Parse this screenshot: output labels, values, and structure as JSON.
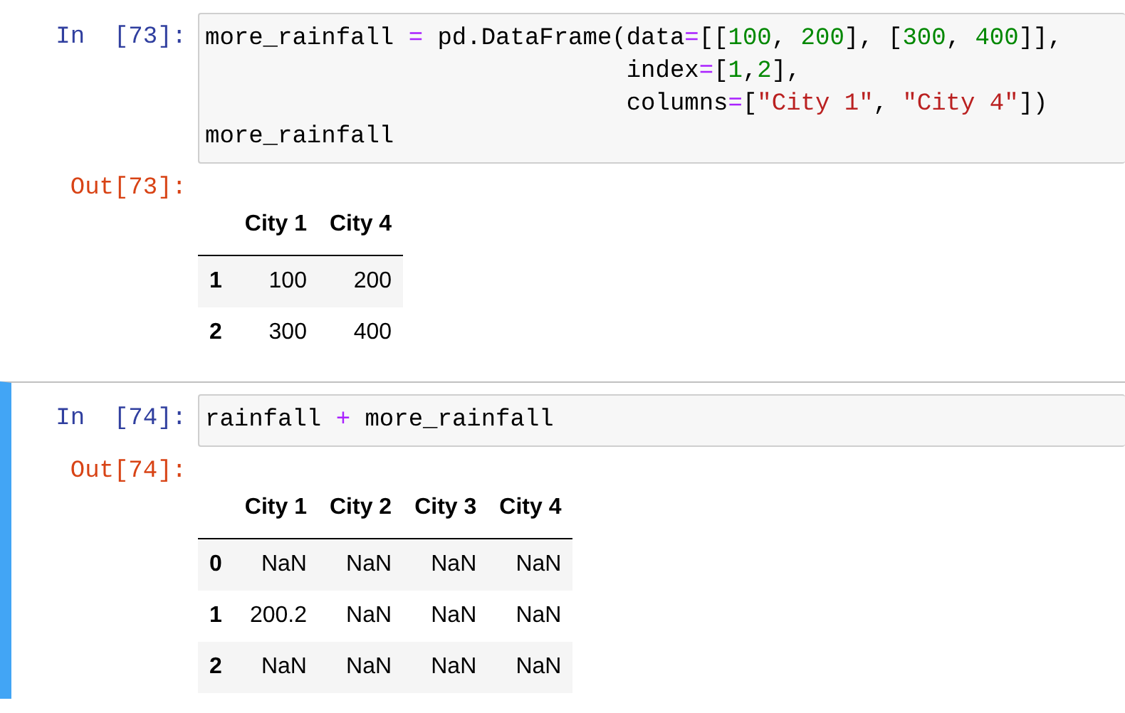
{
  "cells": [
    {
      "selected": false,
      "in_prompt": "In  [73]:",
      "code": [
        [
          {
            "kind": "plain",
            "text": "more_rainfall "
          },
          {
            "kind": "op",
            "text": "="
          },
          {
            "kind": "plain",
            "text": " pd.DataFrame(data"
          },
          {
            "kind": "op",
            "text": "="
          },
          {
            "kind": "plain",
            "text": "[["
          },
          {
            "kind": "num",
            "text": "100"
          },
          {
            "kind": "plain",
            "text": ", "
          },
          {
            "kind": "num",
            "text": "200"
          },
          {
            "kind": "plain",
            "text": "], ["
          },
          {
            "kind": "num",
            "text": "300"
          },
          {
            "kind": "plain",
            "text": ", "
          },
          {
            "kind": "num",
            "text": "400"
          },
          {
            "kind": "plain",
            "text": "]],"
          }
        ],
        [
          {
            "kind": "plain",
            "text": "                             index"
          },
          {
            "kind": "op",
            "text": "="
          },
          {
            "kind": "plain",
            "text": "["
          },
          {
            "kind": "num",
            "text": "1"
          },
          {
            "kind": "plain",
            "text": ","
          },
          {
            "kind": "num",
            "text": "2"
          },
          {
            "kind": "plain",
            "text": "],"
          }
        ],
        [
          {
            "kind": "plain",
            "text": "                             columns"
          },
          {
            "kind": "op",
            "text": "="
          },
          {
            "kind": "plain",
            "text": "["
          },
          {
            "kind": "str",
            "text": "\"City 1\""
          },
          {
            "kind": "plain",
            "text": ", "
          },
          {
            "kind": "str",
            "text": "\"City 4\""
          },
          {
            "kind": "plain",
            "text": "])"
          }
        ],
        [
          {
            "kind": "plain",
            "text": "more_rainfall"
          }
        ]
      ],
      "out_prompt": "Out[73]:",
      "table": {
        "columns": [
          "City 1",
          "City 4"
        ],
        "rows": [
          {
            "index": "1",
            "values": [
              "100",
              "200"
            ]
          },
          {
            "index": "2",
            "values": [
              "300",
              "400"
            ]
          }
        ]
      }
    },
    {
      "selected": true,
      "in_prompt": "In  [74]:",
      "code": [
        [
          {
            "kind": "plain",
            "text": "rainfall "
          },
          {
            "kind": "op",
            "text": "+"
          },
          {
            "kind": "plain",
            "text": " more_rainfall"
          }
        ]
      ],
      "out_prompt": "Out[74]:",
      "table": {
        "columns": [
          "City 1",
          "City 2",
          "City 3",
          "City 4"
        ],
        "rows": [
          {
            "index": "0",
            "values": [
              "NaN",
              "NaN",
              "NaN",
              "NaN"
            ]
          },
          {
            "index": "1",
            "values": [
              "200.2",
              "NaN",
              "NaN",
              "NaN"
            ]
          },
          {
            "index": "2",
            "values": [
              "NaN",
              "NaN",
              "NaN",
              "NaN"
            ]
          }
        ]
      }
    }
  ]
}
